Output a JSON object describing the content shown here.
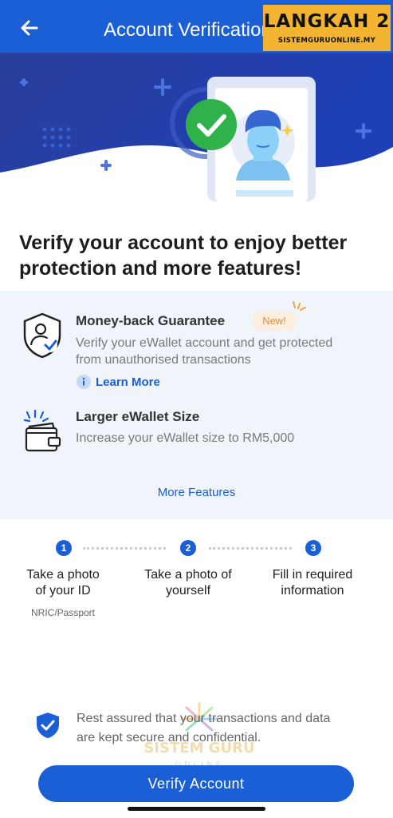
{
  "header": {
    "title": "Account Verification",
    "back_icon": "arrow-left-icon"
  },
  "overlay_banner": {
    "main": "LANGKAH 2",
    "sub": "SISTEMGURUONLINE.MY"
  },
  "headline": "Verify your account to enjoy better protection and more features!",
  "features": [
    {
      "icon": "shield-user-check-icon",
      "title": "Money-back Guarantee",
      "badge": "New!",
      "description_line1": "Verify your eWallet account and get protected",
      "description_line2": "from unauthorised transactions",
      "link": "Learn More"
    },
    {
      "icon": "wallet-sparkle-icon",
      "title": "Larger eWallet Size",
      "description_line1": "Increase your eWallet size to RM5,000"
    }
  ],
  "more_features": "More Features",
  "steps": [
    {
      "number": "1",
      "line1": "Take a photo",
      "line2": "of your ID",
      "sub": "NRIC/Passport"
    },
    {
      "number": "2",
      "line1": "Take a photo of",
      "line2": "yourself"
    },
    {
      "number": "3",
      "line1": "Fill in required",
      "line2": "information"
    }
  ],
  "secure_note": {
    "icon": "shield-check-icon",
    "line1": "Rest assured that your transactions and data",
    "line2": "are kept secure and confidential."
  },
  "watermark": {
    "line1": "SISTEM GURU",
    "line2": "ONLINE"
  },
  "cta": "Verify Account",
  "colors": {
    "primary": "#1a5fd6",
    "banner": "#f2b431",
    "feature_bg": "#f0f4fb",
    "success": "#2fb24a"
  }
}
